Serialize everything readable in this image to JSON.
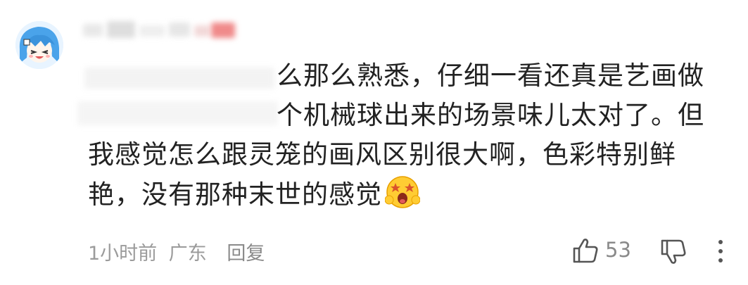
{
  "comment": {
    "lines": [
      "么那么熟悉，仔细一看还真是艺画做",
      "个机械球出来的场景味儿太对了。但",
      "我感觉怎么跟灵笼的画风区别很大啊，色彩特别鲜",
      "艳，没有那种末世的感觉"
    ],
    "emoji": "star-struck-face-icon"
  },
  "meta": {
    "time": "1小时前",
    "location": "广东",
    "reply_label": "回复"
  },
  "actions": {
    "like_count": "53"
  },
  "colors": {
    "text": "#222222",
    "meta": "#9b9b9b",
    "avatar_hair": "#4aa3ea"
  }
}
